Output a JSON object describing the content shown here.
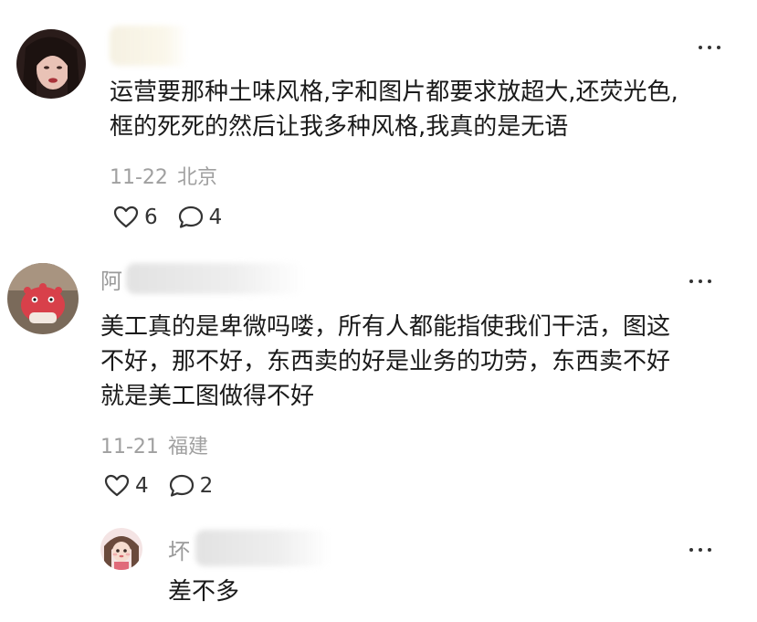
{
  "comments": [
    {
      "username": "",
      "content_lines": [
        "运营要那种土味风格,字和图片都要求放超大,还荧光色,",
        "框的死死的然后让我多种风格,我真的是无语"
      ],
      "date": "11-22",
      "location": "北京",
      "likes": "6",
      "replies": "4"
    },
    {
      "username": "阿",
      "content_lines": [
        "美工真的是卑微吗喽，所有人都能指使我们干活，图这",
        "不好，那不好，东西卖的好是业务的功劳，东西卖不好",
        "就是美工图做得不好"
      ],
      "date": "11-21",
      "location": "福建",
      "likes": "4",
      "replies": "2"
    }
  ],
  "reply": {
    "username": "坏",
    "content": "差不多"
  },
  "icons": {
    "like": "heart-icon",
    "comment": "comment-bubble-icon",
    "more": "more-dots-icon"
  },
  "colors": {
    "text": "#1a1a1a",
    "meta": "#a0a0a0",
    "name": "#9a9a9a"
  }
}
